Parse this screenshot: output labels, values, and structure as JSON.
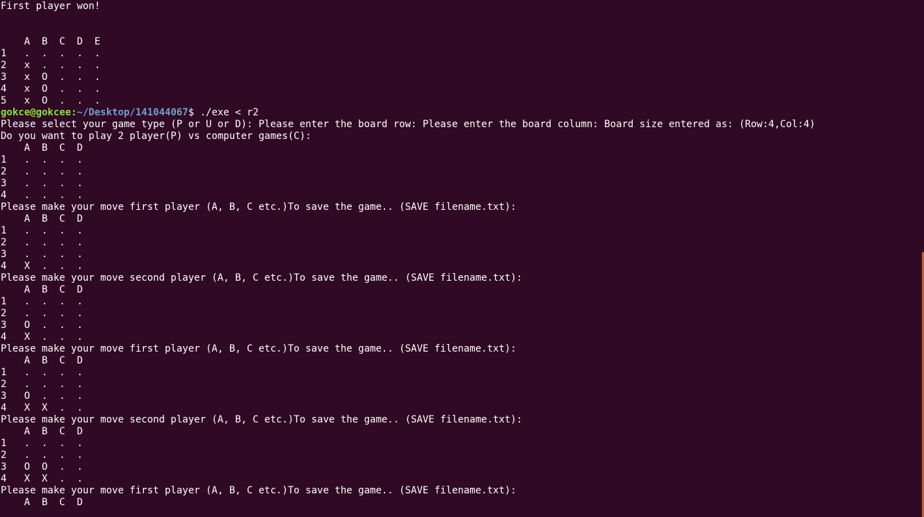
{
  "terminal": {
    "prompt": {
      "user_host": "gokce@gokcee:",
      "path": "~/Desktop/141044067",
      "symbol": "$ ",
      "command": "./exe < r2"
    },
    "lines_before": [
      "First player won!",
      "",
      "",
      "    A  B  C  D  E",
      "1   .  .  .  .  .",
      "2   x  .  .  .  .",
      "3   x  O  .  .  .",
      "4   x  O  .  .  .",
      "5   x  O  .  .  ."
    ],
    "lines_after": [
      "Please select your game type (P or U or D): Please enter the board row: Please enter the board column: Board size entered as: (Row:4,Col:4)",
      "Do you want to play 2 player(P) vs computer games(C):",
      "    A  B  C  D",
      "1   .  .  .  .",
      "2   .  .  .  .",
      "3   .  .  .  .",
      "4   .  .  .  .",
      "Please make your move first player (A, B, C etc.)To save the game.. (SAVE filename.txt):",
      "    A  B  C  D",
      "1   .  .  .  .",
      "2   .  .  .  .",
      "3   .  .  .  .",
      "4   X  .  .  .",
      "Please make your move second player (A, B, C etc.)To save the game.. (SAVE filename.txt):",
      "    A  B  C  D",
      "1   .  .  .  .",
      "2   .  .  .  .",
      "3   O  .  .  .",
      "4   X  .  .  .",
      "Please make your move first player (A, B, C etc.)To save the game.. (SAVE filename.txt):",
      "    A  B  C  D",
      "1   .  .  .  .",
      "2   .  .  .  .",
      "3   O  .  .  .",
      "4   X  X  .  .",
      "Please make your move second player (A, B, C etc.)To save the game.. (SAVE filename.txt):",
      "    A  B  C  D",
      "1   .  .  .  .",
      "2   .  .  .  .",
      "3   O  O  .  .",
      "4   X  X  .  .",
      "Please make your move first player (A, B, C etc.)To save the game.. (SAVE filename.txt):",
      "    A  B  C  D"
    ]
  },
  "colors": {
    "background": "#300a24",
    "text": "#ffffff",
    "prompt_user": "#8ae234",
    "prompt_path": "#729fcf",
    "scrollbar": "#c0623b"
  }
}
